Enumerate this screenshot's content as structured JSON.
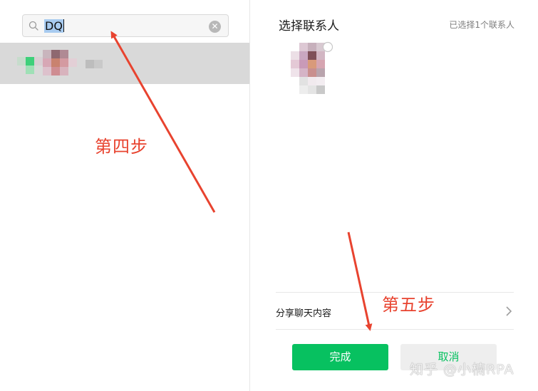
{
  "search": {
    "value": "DQ",
    "clear_icon": "clear-icon"
  },
  "right": {
    "title": "选择联系人",
    "selected_count": "已选择1个联系人",
    "share_label": "分享聊天内容",
    "confirm_label": "完成",
    "cancel_label": "取消"
  },
  "annotations": {
    "step4": "第四步",
    "step5": "第五步"
  },
  "watermark": "知乎 @小楠RPA",
  "colors": {
    "accent": "#07c160",
    "annotation": "#e8432f",
    "selected_row": "#d9d9d9"
  }
}
